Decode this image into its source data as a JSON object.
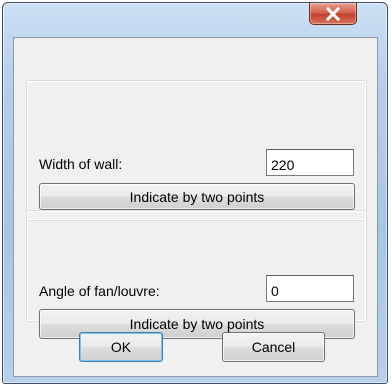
{
  "window": {
    "close_icon": "close-x-icon"
  },
  "wall_group": {
    "label": "Width  of  wall:",
    "value": "220",
    "pick_button": "Indicate by two points"
  },
  "angle_group": {
    "label": "Angle of fan/louvre:",
    "value": "0",
    "pick_button": "Indicate by two points"
  },
  "footer": {
    "ok_label": "OK",
    "cancel_label": "Cancel"
  },
  "colors": {
    "close_button": "#c9503a",
    "frame": "#aecbe8",
    "client_bg": "#f0f0f0",
    "default_button_border": "#3c7fb1"
  }
}
